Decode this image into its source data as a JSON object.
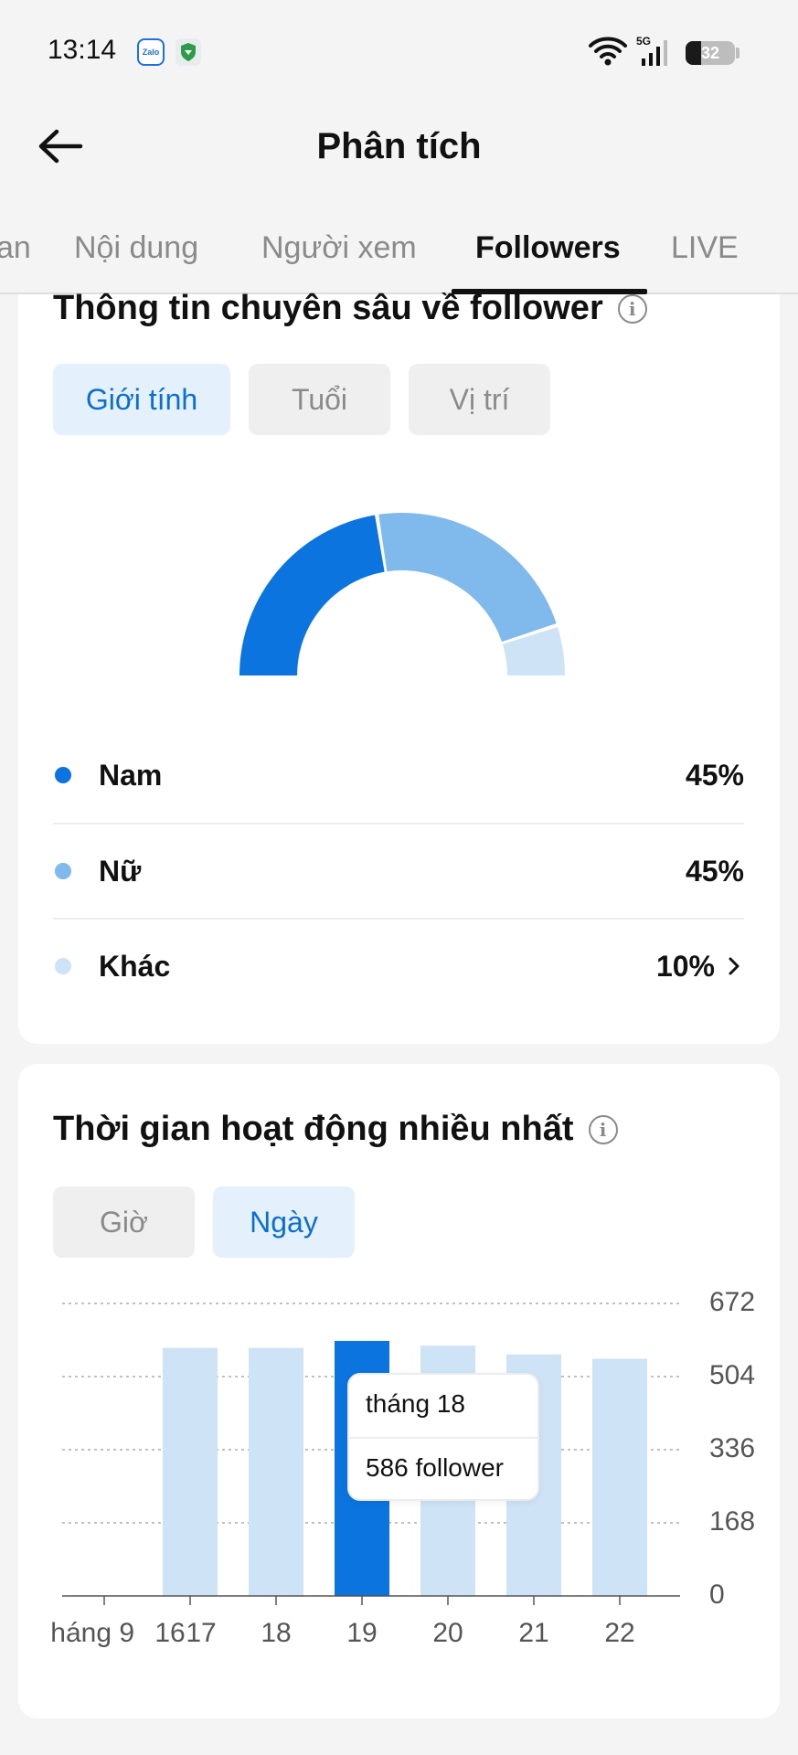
{
  "status_bar": {
    "time": "13:14",
    "zalo_label": "Zalo",
    "network": "5G",
    "battery": "32",
    "battery_level": 0.32
  },
  "header": {
    "title": "Phân tích"
  },
  "tabs": [
    {
      "label": "an"
    },
    {
      "label": "Nội dung"
    },
    {
      "label": "Người xem"
    },
    {
      "label": "Followers",
      "active": true
    },
    {
      "label": "LIVE"
    }
  ],
  "insights": {
    "title": "Thông tin chuyên sâu về follower",
    "filters": [
      {
        "label": "Giới tính",
        "active": true
      },
      {
        "label": "Tuổi"
      },
      {
        "label": "Vị trí"
      }
    ],
    "gender": [
      {
        "label": "Nam",
        "value": "45%",
        "percent": 45,
        "color": "#0b74de"
      },
      {
        "label": "Nữ",
        "value": "45%",
        "percent": 45,
        "color": "#80b9eb"
      },
      {
        "label": "Khác",
        "value": "10%",
        "percent": 10,
        "color": "#cfe3f7"
      }
    ]
  },
  "activity": {
    "title": "Thời gian hoạt động nhiều nhất",
    "filters": [
      {
        "label": "Giờ"
      },
      {
        "label": "Ngày",
        "active": true
      }
    ],
    "tooltip": {
      "line1": "tháng 18",
      "line2": "586 follower"
    }
  },
  "chart_data": {
    "type": "bar",
    "categories": [
      "háng 9",
      "16",
      "17",
      "18",
      "19",
      "20",
      "21",
      "22"
    ],
    "values": [
      null,
      570,
      570,
      586,
      575,
      555,
      545,
      null
    ],
    "highlight_index": 3,
    "y_ticks": [
      "672",
      "504",
      "336",
      "168",
      "0"
    ],
    "ylim": [
      0,
      672
    ],
    "grid": true,
    "colors": {
      "bar": "#cfe3f7",
      "highlight": "#0b74de"
    }
  }
}
